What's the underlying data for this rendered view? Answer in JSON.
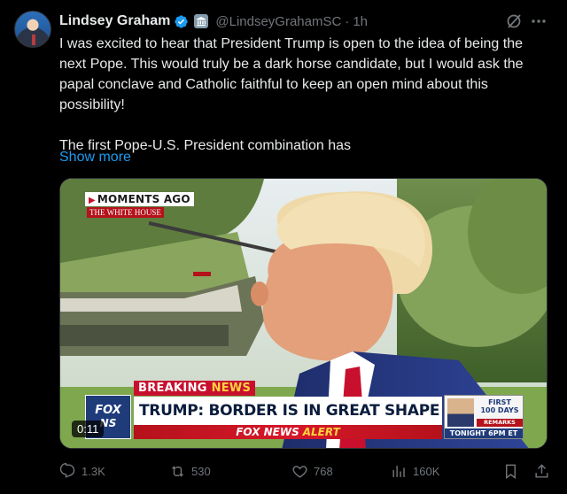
{
  "tweet": {
    "author_name": "Lindsey Graham",
    "handle": "@LindseyGrahamSC",
    "separator": "·",
    "time": "1h",
    "paragraph1": "I was excited to hear that President Trump is open to the idea of being the next Pope. This would truly be a dark horse candidate, but I would ask the papal conclave and Catholic faithful to keep an open mind about this possibility!",
    "paragraph2": "The first Pope-U.S. President combination has",
    "show_more": "Show more"
  },
  "video": {
    "moments_label": "MOMENTS AGO",
    "location_label": "THE WHITE HOUSE",
    "breaking_word": "BREAKING",
    "news_word": "NEWS",
    "headline": "TRUMP: BORDER IS IN GREAT SHAPE",
    "alert_brand": "FOX NEWS",
    "alert_word": "ALERT",
    "logo_line1": "FOX",
    "logo_line2": "NS",
    "promo_line1": "FIRST",
    "promo_line2": "100 DAYS",
    "promo_line3": "REMARKS",
    "promo_line4": "TONIGHT 6PM ET",
    "duration": "0:11"
  },
  "actions": {
    "replies": "1.3K",
    "reposts": "530",
    "likes": "768",
    "views": "160K"
  },
  "colors": {
    "background": "#000000",
    "text": "#e7e9ea",
    "muted": "#71767b",
    "link": "#1d9bf0",
    "verified": "#1d9bf0",
    "fox_red": "#c8102e",
    "fox_blue": "#1f3b7a"
  },
  "icons": [
    "verified-badge-icon",
    "government-badge-icon",
    "grok-icon",
    "more-icon",
    "reply-icon",
    "repost-icon",
    "like-icon",
    "views-icon",
    "bookmark-icon",
    "share-icon"
  ]
}
